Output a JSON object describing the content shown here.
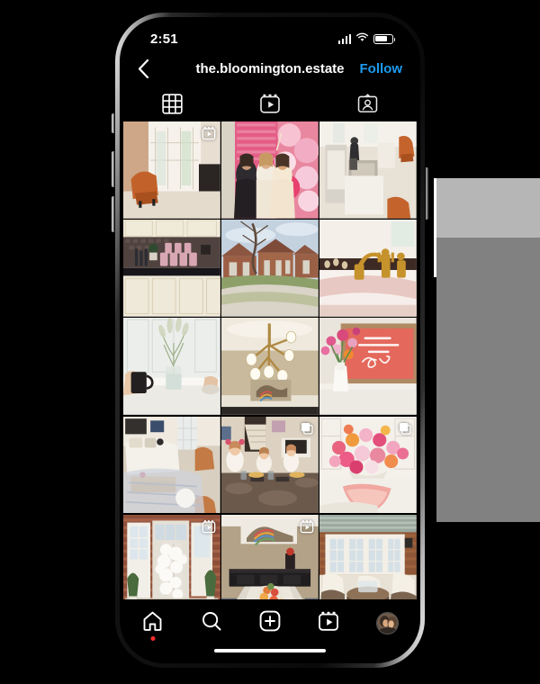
{
  "app": {
    "name": "Instagram",
    "accent_color": "#1e9bf0",
    "background_color": "#000000"
  },
  "background": {
    "panel_light_color": "#b6b6b6",
    "panel_dark_color": "#818181"
  },
  "status_bar": {
    "time": "2:51",
    "cellular_icon": "signal-bars-icon",
    "wifi_icon": "wifi-icon",
    "battery_icon": "battery-icon",
    "battery_level_percent": 72
  },
  "header": {
    "back_icon": "chevron-left-icon",
    "username": "the.bloomington.estate",
    "follow_label": "Follow"
  },
  "profile_tabs": [
    {
      "id": "grid",
      "icon": "grid-icon",
      "label": "Posts",
      "selected": true
    },
    {
      "id": "reels",
      "icon": "reels-icon",
      "label": "Reels",
      "selected": false
    },
    {
      "id": "tagged",
      "icon": "tagged-icon",
      "label": "Tagged",
      "selected": false
    }
  ],
  "grid": {
    "columns": 3,
    "posts": [
      {
        "id": "p1",
        "description": "Living room with orange lounge chair and french doors",
        "badge": "reels-icon"
      },
      {
        "id": "p2",
        "description": "Three women celebrating with pink balloons and sequin backdrop",
        "badge": null
      },
      {
        "id": "p3",
        "description": "Overhead view of white sectional sofa and orange chair",
        "badge": null
      },
      {
        "id": "p4",
        "description": "Kitchen bar with pink tumblers and cream cabinets",
        "badge": null
      },
      {
        "id": "p5",
        "description": "Brick house exterior with driveway and front lawn",
        "badge": null
      },
      {
        "id": "p6",
        "description": "Gold bathtub faucet with candles",
        "badge": null
      },
      {
        "id": "p7",
        "description": "Glass vase with pampas grass and black coffee mug on counter",
        "badge": null
      },
      {
        "id": "p8",
        "description": "Brass sputnik chandelier over dining area",
        "badge": null
      },
      {
        "id": "p9",
        "description": "Coral sign reading WE HAVE SO MANY REASONS TO BE happy with flower vase",
        "badge": null,
        "sign_text_lines": [
          "WE HAVE",
          "SO MANY REASONS",
          "TO BE",
          "happy"
        ]
      },
      {
        "id": "p10",
        "description": "White sofa living room with orange accent chairs and striped rug",
        "badge": null
      },
      {
        "id": "p11",
        "description": "Three children eating at granite kitchen island",
        "badge": "carousel-icon"
      },
      {
        "id": "p12",
        "description": "Large pink and orange flower arrangement in pedestal bowl",
        "badge": "carousel-icon"
      },
      {
        "id": "p13",
        "description": "Front door decorated with white balloon arch",
        "badge": "reels-icon"
      },
      {
        "id": "p14",
        "description": "Dining table with autumn floral runner and black buffet",
        "badge": "reels-icon"
      },
      {
        "id": "p15",
        "description": "Covered patio with wicker furniture and fire table",
        "badge": null
      }
    ]
  },
  "bottom_nav": [
    {
      "id": "home",
      "icon": "home-icon",
      "label": "Home",
      "badge_dot": true
    },
    {
      "id": "search",
      "icon": "search-icon",
      "label": "Search",
      "badge_dot": false
    },
    {
      "id": "create",
      "icon": "plus-square-icon",
      "label": "Create",
      "badge_dot": false
    },
    {
      "id": "reels",
      "icon": "reels-icon",
      "label": "Reels",
      "badge_dot": false
    },
    {
      "id": "profile",
      "icon": "avatar-icon",
      "label": "Profile",
      "badge_dot": false
    }
  ],
  "system": {
    "home_indicator": "home-indicator-bar"
  }
}
